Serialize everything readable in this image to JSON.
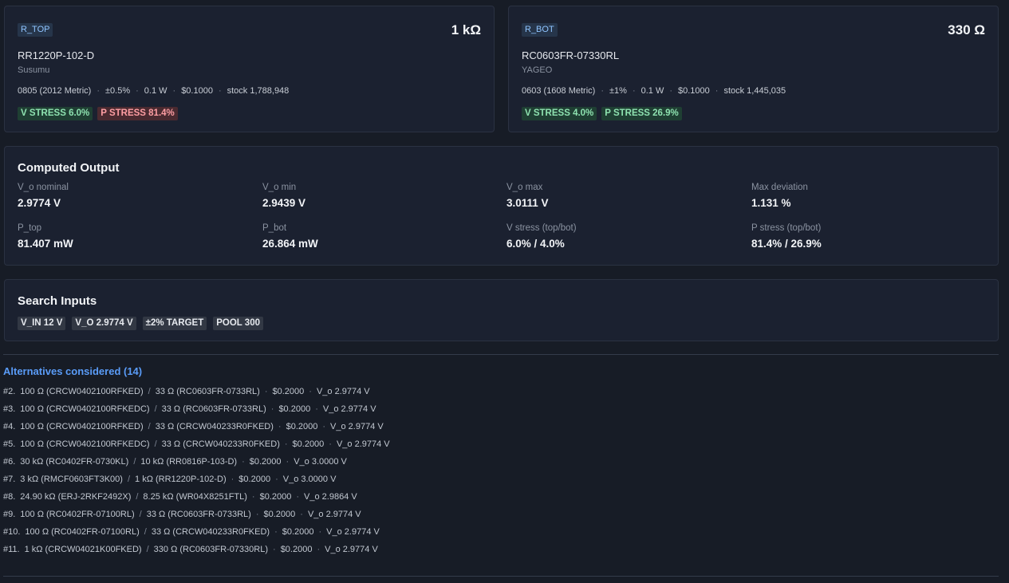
{
  "r_top": {
    "tag": "R_TOP",
    "value": "1 kΩ",
    "part_number": "RR1220P-102-D",
    "manufacturer": "Susumu",
    "package": "0805 (2012 Metric)",
    "tolerance": "±0.5%",
    "power": "0.1 W",
    "price": "$0.1000",
    "stock": "stock 1,788,948",
    "v_stress_badge": "V STRESS 6.0%",
    "p_stress_badge": "P STRESS 81.4%"
  },
  "r_bot": {
    "tag": "R_BOT",
    "value": "330 Ω",
    "part_number": "RC0603FR-07330RL",
    "manufacturer": "YAGEO",
    "package": "0603 (1608 Metric)",
    "tolerance": "±1%",
    "power": "0.1 W",
    "price": "$0.1000",
    "stock": "stock 1,445,035",
    "v_stress_badge": "V STRESS 4.0%",
    "p_stress_badge": "P STRESS 26.9%"
  },
  "computed": {
    "title": "Computed Output",
    "metrics": [
      {
        "label": "V_o nominal",
        "value": "2.9774 V"
      },
      {
        "label": "V_o min",
        "value": "2.9439 V"
      },
      {
        "label": "V_o max",
        "value": "3.0111 V"
      },
      {
        "label": "Max deviation",
        "value": "1.131 %"
      },
      {
        "label": "P_top",
        "value": "81.407 mW"
      },
      {
        "label": "P_bot",
        "value": "26.864 mW"
      },
      {
        "label": "V stress (top/bot)",
        "value": "6.0% / 4.0%"
      },
      {
        "label": "P stress (top/bot)",
        "value": "81.4% / 26.9%"
      }
    ]
  },
  "search": {
    "title": "Search Inputs",
    "chips": [
      "V_IN 12 V",
      "V_O 2.9774 V",
      "±2% TARGET",
      "POOL 300"
    ]
  },
  "alternatives": {
    "title": "Alternatives considered (14)",
    "items": [
      {
        "rank": "#2.",
        "top": "100 Ω (CRCW0402100RFKED)",
        "bot": "33 Ω (RC0603FR-0733RL)",
        "price": "$0.2000",
        "vo": "V_o 2.9774 V"
      },
      {
        "rank": "#3.",
        "top": "100 Ω (CRCW0402100RFKEDC)",
        "bot": "33 Ω (RC0603FR-0733RL)",
        "price": "$0.2000",
        "vo": "V_o 2.9774 V"
      },
      {
        "rank": "#4.",
        "top": "100 Ω (CRCW0402100RFKED)",
        "bot": "33 Ω (CRCW040233R0FKED)",
        "price": "$0.2000",
        "vo": "V_o 2.9774 V"
      },
      {
        "rank": "#5.",
        "top": "100 Ω (CRCW0402100RFKEDC)",
        "bot": "33 Ω (CRCW040233R0FKED)",
        "price": "$0.2000",
        "vo": "V_o 2.9774 V"
      },
      {
        "rank": "#6.",
        "top": "30 kΩ (RC0402FR-0730KL)",
        "bot": "10 kΩ (RR0816P-103-D)",
        "price": "$0.2000",
        "vo": "V_o 3.0000 V"
      },
      {
        "rank": "#7.",
        "top": "3 kΩ (RMCF0603FT3K00)",
        "bot": "1 kΩ (RR1220P-102-D)",
        "price": "$0.2000",
        "vo": "V_o 3.0000 V"
      },
      {
        "rank": "#8.",
        "top": "24.90 kΩ (ERJ-2RKF2492X)",
        "bot": "8.25 kΩ (WR04X8251FTL)",
        "price": "$0.2000",
        "vo": "V_o 2.9864 V"
      },
      {
        "rank": "#9.",
        "top": "100 Ω (RC0402FR-07100RL)",
        "bot": "33 Ω (RC0603FR-0733RL)",
        "price": "$0.2000",
        "vo": "V_o 2.9774 V"
      },
      {
        "rank": "#10.",
        "top": "100 Ω (RC0402FR-07100RL)",
        "bot": "33 Ω (CRCW040233R0FKED)",
        "price": "$0.2000",
        "vo": "V_o 2.9774 V"
      },
      {
        "rank": "#11.",
        "top": "1 kΩ (CRCW04021K00FKED)",
        "bot": "330 Ω (RC0603FR-07330RL)",
        "price": "$0.2000",
        "vo": "V_o 2.9774 V"
      }
    ]
  },
  "colors": {
    "background": "#171c26",
    "card": "#1b2130",
    "accent": "#5a9cf8",
    "ok_badge_text": "#8ee2b0",
    "bad_badge_text": "#ff9ea3"
  }
}
